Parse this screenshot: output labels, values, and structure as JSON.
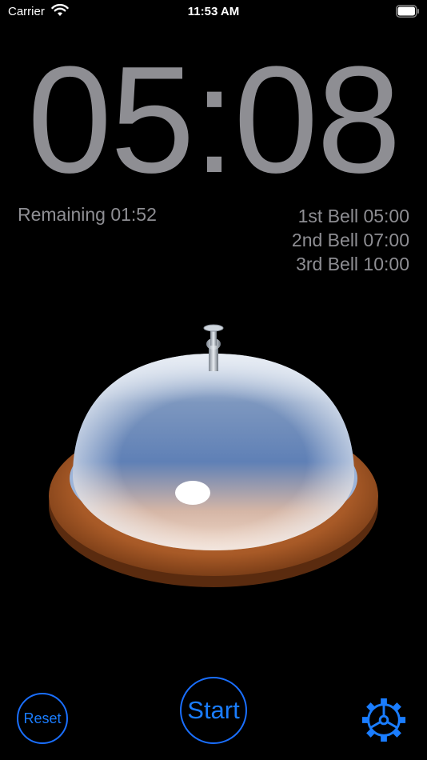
{
  "status_bar": {
    "carrier": "Carrier",
    "time": "11:53 AM"
  },
  "timer": {
    "elapsed": "05:08",
    "remaining_label": "Remaining 01:52"
  },
  "bells": [
    {
      "label": "1st Bell 05:00"
    },
    {
      "label": "2nd Bell 07:00"
    },
    {
      "label": "3rd Bell 10:00"
    }
  ],
  "controls": {
    "reset_label": "Reset",
    "start_label": "Start",
    "settings_icon": "gear-icon"
  },
  "colors": {
    "background": "#000000",
    "text_gray": "#8e8e93",
    "accent_blue": "#1a7dff"
  }
}
